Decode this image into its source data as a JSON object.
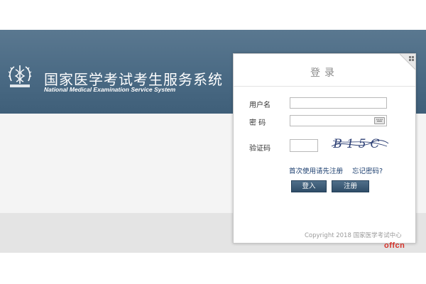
{
  "site": {
    "title": "国家医学考试考生服务系统",
    "subtitle": "National Medical Examination Service System"
  },
  "login": {
    "title": "登录",
    "username_label": "用户名",
    "username_value": "",
    "password_label": "密 码",
    "password_value": "",
    "captcha_label": "验证码",
    "captcha_value": "",
    "captcha_text": "B15C",
    "register_hint_link": "首次使用请先注册",
    "forgot_password_link": "忘记密码?",
    "login_button": "登入",
    "register_button": "注册",
    "copyright": "Copyright 2018 国家医学考试中心"
  },
  "watermark": {
    "text": "offcn",
    "color": "#d6322a"
  },
  "colors": {
    "banner": "#4a6a84",
    "button": "#3f5f79",
    "link": "#1a3d6e"
  },
  "icons": {
    "emblem": "medical-emblem-icon",
    "keyboard": "keyboard-icon",
    "corner": "corner-switch-icon"
  }
}
